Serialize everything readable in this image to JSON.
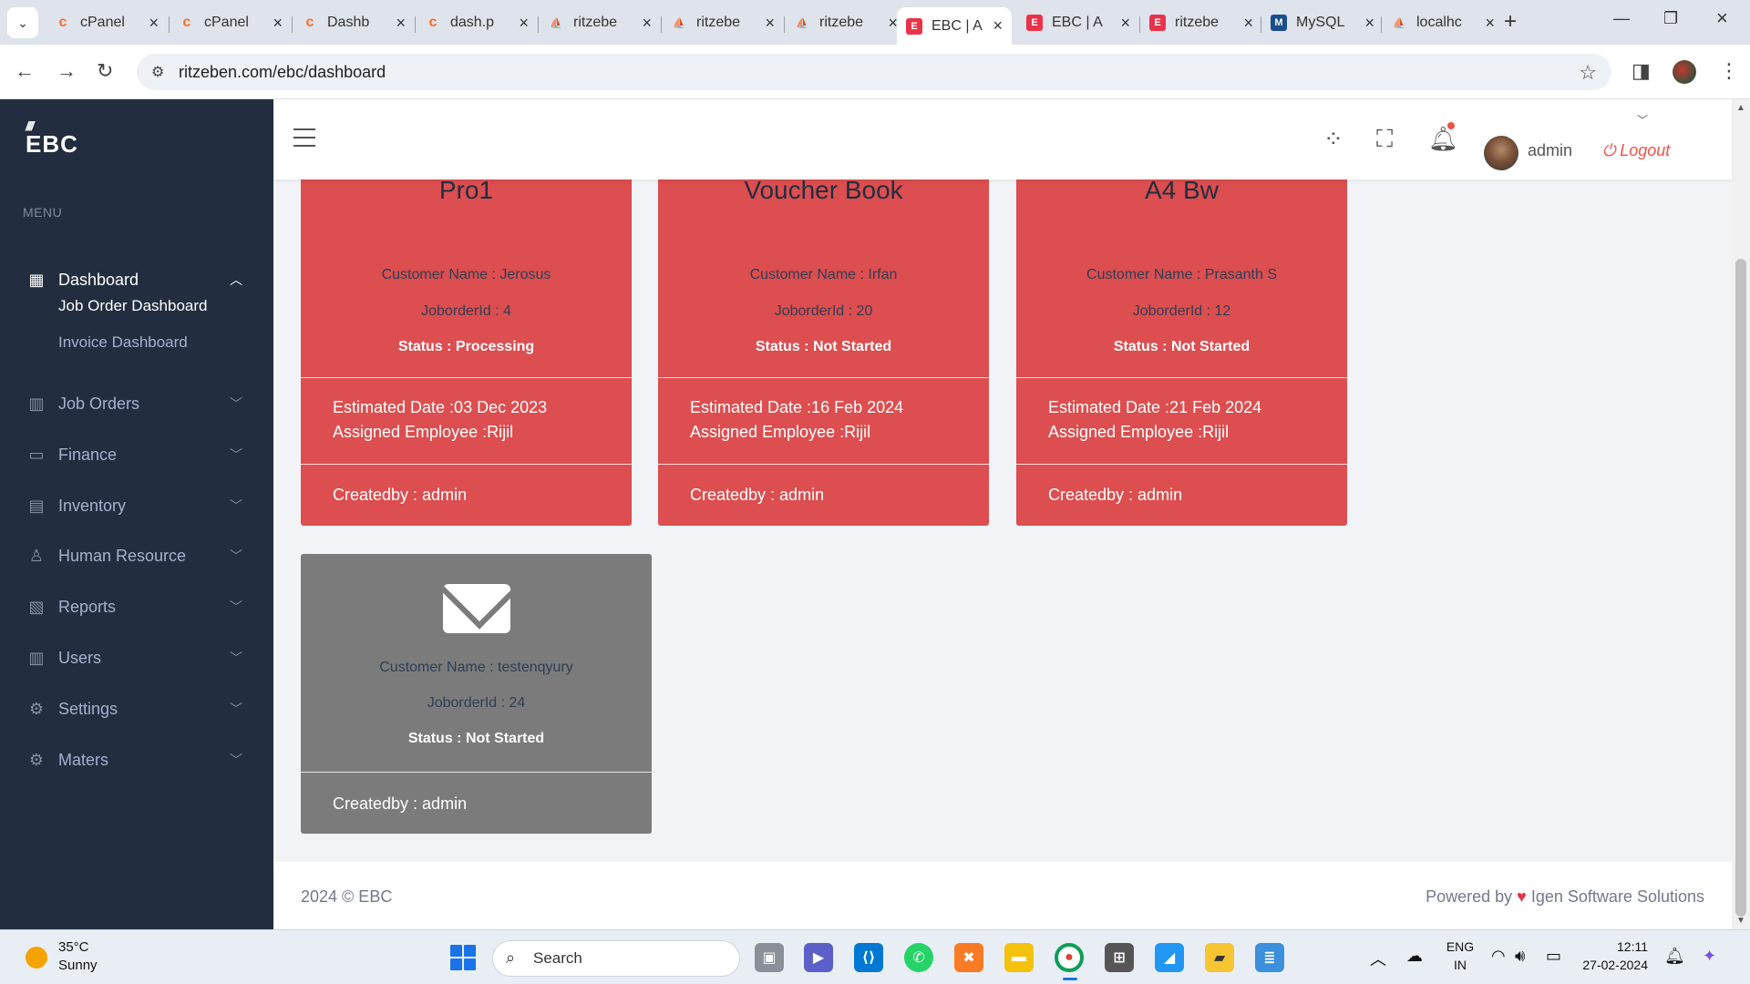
{
  "browser": {
    "tabs": [
      {
        "label": "cPanel",
        "favicon": "cpanel-icon",
        "active": false
      },
      {
        "label": "cPanel",
        "favicon": "cpanel-icon",
        "active": false
      },
      {
        "label": "Dashb",
        "favicon": "cpanel-icon",
        "active": false
      },
      {
        "label": "dash.p",
        "favicon": "cpanel-icon",
        "active": false
      },
      {
        "label": "ritzebe",
        "favicon": "phpmyadmin-icon",
        "active": false
      },
      {
        "label": "ritzebe",
        "favicon": "phpmyadmin-icon",
        "active": false
      },
      {
        "label": "ritzebe",
        "favicon": "phpmyadmin-icon",
        "active": false
      },
      {
        "label": "EBC | A",
        "favicon": "ebc-icon",
        "active": true
      },
      {
        "label": "EBC | A",
        "favicon": "ebc-icon",
        "active": false
      },
      {
        "label": "ritzebe",
        "favicon": "ebc-icon",
        "active": false
      },
      {
        "label": "MySQL",
        "favicon": "mysql-icon",
        "active": false
      },
      {
        "label": "localhc",
        "favicon": "phpmyadmin-icon",
        "active": false
      }
    ],
    "url": "ritzeben.com/ebc/dashboard"
  },
  "sidebar": {
    "logo": "EBC",
    "menu_title": "MENU",
    "items": [
      {
        "label": "Dashboard",
        "icon": "dashboard-icon"
      },
      {
        "label": "Job Orders",
        "icon": "book-icon"
      },
      {
        "label": "Finance",
        "icon": "credit-card-icon"
      },
      {
        "label": "Inventory",
        "icon": "clipboard-icon"
      },
      {
        "label": "Human Resource",
        "icon": "user-icon"
      },
      {
        "label": "Reports",
        "icon": "report-icon"
      },
      {
        "label": "Users",
        "icon": "book-icon"
      },
      {
        "label": "Settings",
        "icon": "gear-icon"
      },
      {
        "label": "Maters",
        "icon": "gear-icon"
      }
    ],
    "dashboard_sub": [
      "Job Order Dashboard",
      "Invoice Dashboard"
    ]
  },
  "topbar": {
    "user": "admin",
    "logout": "Logout"
  },
  "cards": [
    {
      "title": "Pro1",
      "customer": "Customer Name : Jerosus",
      "joborder": "JoborderId : 4",
      "status": "Status : Processing",
      "estimated": "Estimated Date :03 Dec 2023",
      "employee": "Assigned Employee :Rijil",
      "createdby": "Createdby : admin"
    },
    {
      "title": "Voucher Book",
      "customer": "Customer Name : Irfan",
      "joborder": "JoborderId : 20",
      "status": "Status : Not Started",
      "estimated": "Estimated Date :16 Feb 2024",
      "employee": "Assigned Employee :Rijil",
      "createdby": "Createdby : admin"
    },
    {
      "title": "A4 Bw",
      "customer": "Customer Name : Prasanth S",
      "joborder": "JoborderId : 12",
      "status": "Status : Not Started",
      "estimated": "Estimated Date :21 Feb 2024",
      "employee": "Assigned Employee :Rijil",
      "createdby": "Createdby : admin"
    },
    {
      "title": "",
      "customer": "Customer Name : testenqyury",
      "joborder": "JoborderId : 24",
      "status": "Status : Not Started",
      "createdby": "Createdby : admin"
    }
  ],
  "colors": {
    "card_red": "#dc4e4f",
    "card_grey": "#7b7b7b",
    "sidebar": "#222e3f",
    "logout": "#f0524a"
  },
  "footer": {
    "copyright": "2024 © EBC",
    "powered_prefix": "Powered by",
    "powered_company": "Igen Software Solutions"
  },
  "taskbar": {
    "temperature": "35°C",
    "condition": "Sunny",
    "search_placeholder": "Search",
    "lang_top": "ENG",
    "lang_bottom": "IN",
    "time": "12:11",
    "date": "27-02-2024"
  }
}
